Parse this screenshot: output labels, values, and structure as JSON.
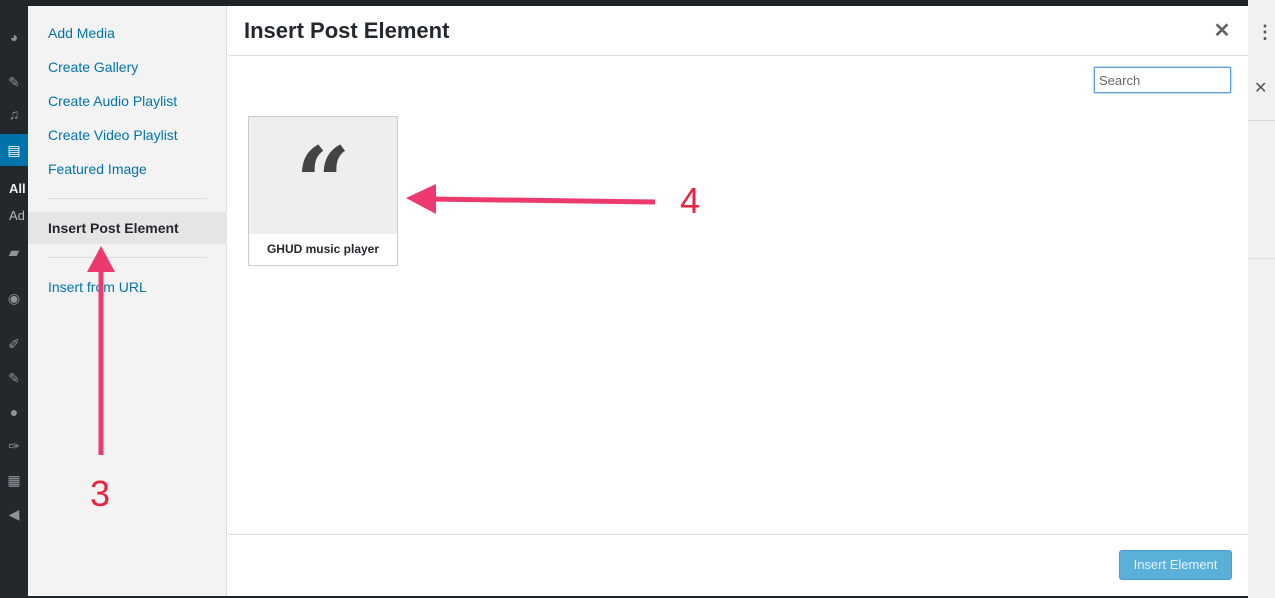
{
  "admin_background": {
    "rail_labels": [
      "All",
      "Ad"
    ]
  },
  "modal": {
    "menu": {
      "items": [
        {
          "label": "Add Media"
        },
        {
          "label": "Create Gallery"
        },
        {
          "label": "Create Audio Playlist"
        },
        {
          "label": "Create Video Playlist"
        },
        {
          "label": "Featured Image"
        },
        {
          "label": "Insert Post Element",
          "active": true
        },
        {
          "label": "Insert from URL"
        }
      ]
    },
    "title": "Insert Post Element",
    "close_icon": "close-icon",
    "search": {
      "placeholder": "Search",
      "value": ""
    },
    "elements": [
      {
        "label": "GHUD music player",
        "icon": "quote-icon"
      }
    ],
    "footer": {
      "insert_label": "Insert Element"
    }
  },
  "annotations": {
    "step3_label": "3",
    "step4_label": "4",
    "color": "#e8243f"
  },
  "colors": {
    "link": "#0073aa",
    "primary_button": "#5bb0d9",
    "admin_bar": "#23282d"
  }
}
